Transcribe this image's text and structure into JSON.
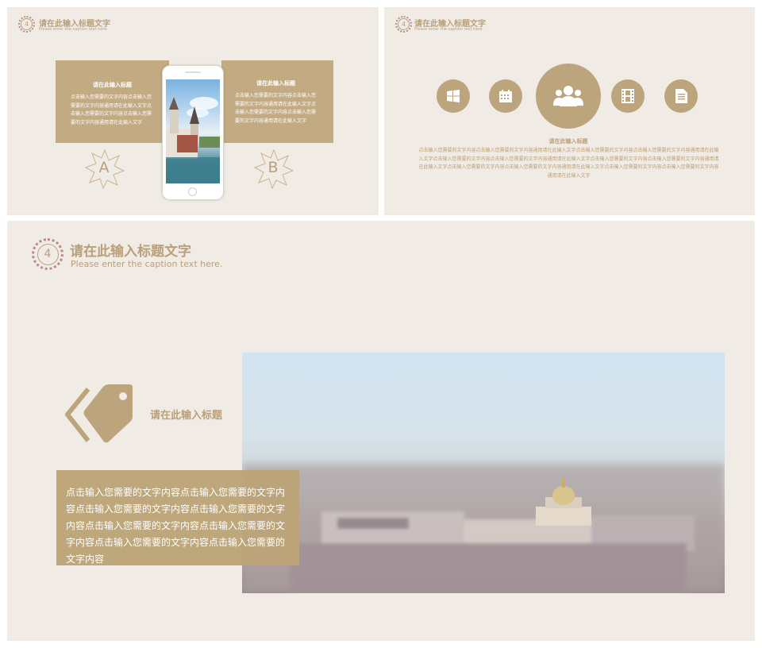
{
  "slide1": {
    "header_title": "请在此输入标题文字",
    "header_caption": "Please enter the caption text here.",
    "badge_number": "4",
    "left_title": "请在此输入标题",
    "left_body": "点击输入您需要的文字内容点击输入您需要的文字内容通用请在此输入文字点击输入您需要的文字内容点击输入您需要的文字内容通用请在此输入文字",
    "right_title": "请在此输入标题",
    "right_body": "点击输入您需要的文字内容点击输入您需要的文字内容通用请在此输入文字点击输入您需要的文字内容点击输入您需要的文字内容通用请在此输入文字",
    "star_a": "A",
    "star_b": "B"
  },
  "slide2": {
    "header_title": "请在此输入标题文字",
    "header_caption": "Please enter the caption text here.",
    "badge_number": "4",
    "icons": [
      "windows-icon",
      "calendar-icon",
      "users-icon",
      "film-icon",
      "document-icon"
    ],
    "center_title": "请在此输入标题",
    "center_body": "点击输入您需要的文字内容点击输入您需要的文字内容通用请在此输入文字点击输入您需要的文字内容点击输入您需要的文字内容通用请在此输入文字点击输入您需要的文字内容点击输入您需要的文字内容通用请在此输入文字点击输入您需要的文字内容点击输入您需要的文字内容通用请在此输入文字点击输入您需要的文字内容点击输入您需要的文字内容通用请在此输入文字点击输入您需要的文字内容点击输入您需要的文字内容通用请在此输入文字"
  },
  "slide3": {
    "header_title": "请在此输入标题文字",
    "header_caption": "Please enter the caption text here.",
    "badge_number": "4",
    "tag_title": "请在此输入标题",
    "box_body": "点击输入您需要的文字内容点击输入您需要的文字内容点击输入您需要的文字内容点击输入您需要的文字内容点击输入您需要的文字内容点击输入您需要的文字内容点击输入您需要的文字内容点击输入您需要的文字内容"
  },
  "colors": {
    "background": "#f0ebe4",
    "accent": "#c2ab83",
    "text_accent": "#b9a07a"
  }
}
